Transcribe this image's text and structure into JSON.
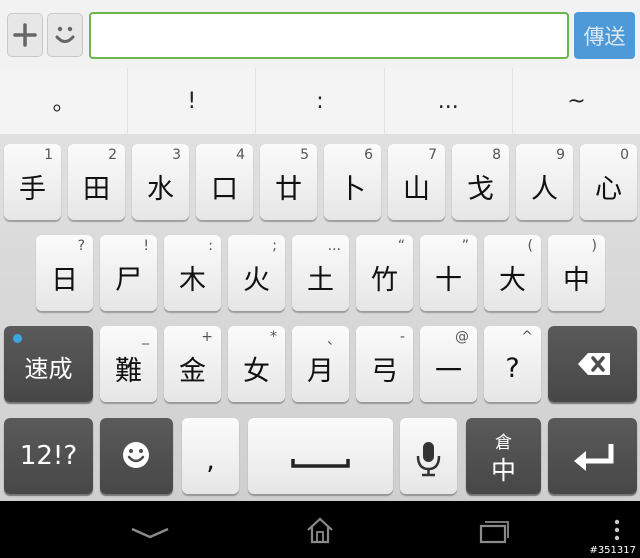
{
  "composer": {
    "send_label": "傳送",
    "input_value": "",
    "attach_icon": "plus-icon",
    "emoji_icon": "smiley-icon"
  },
  "suggestions": [
    "。",
    "!",
    ":",
    "...",
    "~"
  ],
  "keyboard": {
    "row1": [
      {
        "main": "手",
        "sub": "1"
      },
      {
        "main": "田",
        "sub": "2"
      },
      {
        "main": "水",
        "sub": "3"
      },
      {
        "main": "口",
        "sub": "4"
      },
      {
        "main": "廿",
        "sub": "5"
      },
      {
        "main": "卜",
        "sub": "6"
      },
      {
        "main": "山",
        "sub": "7"
      },
      {
        "main": "戈",
        "sub": "8"
      },
      {
        "main": "人",
        "sub": "9"
      },
      {
        "main": "心",
        "sub": "0"
      }
    ],
    "row2": [
      {
        "main": "日",
        "sub": "?"
      },
      {
        "main": "尸",
        "sub": "!"
      },
      {
        "main": "木",
        "sub": ":"
      },
      {
        "main": "火",
        "sub": ";"
      },
      {
        "main": "土",
        "sub": "..."
      },
      {
        "main": "竹",
        "sub": "“"
      },
      {
        "main": "十",
        "sub": "”"
      },
      {
        "main": "大",
        "sub": "("
      },
      {
        "main": "中",
        "sub": ")"
      }
    ],
    "row3": [
      {
        "main": "難",
        "sub": "_"
      },
      {
        "main": "金",
        "sub": "+"
      },
      {
        "main": "女",
        "sub": "*"
      },
      {
        "main": "月",
        "sub": "、"
      },
      {
        "main": "弓",
        "sub": "-"
      },
      {
        "main": "一",
        "sub": "@"
      },
      {
        "main": "?",
        "sub": "^"
      }
    ],
    "mode_label": "速成",
    "symbols_label": "12!?",
    "comma_label": ",",
    "lang_top": "倉",
    "lang_main": "中",
    "backspace_icon": "backspace-icon",
    "enter_icon": "enter-icon",
    "emoji_icon": "smiley-icon",
    "space_icon": "space-icon",
    "mic_icon": "microphone-icon"
  },
  "navbar": {
    "back_icon": "back-chevron-icon",
    "home_icon": "home-icon",
    "recents_icon": "recents-icon",
    "menu_icon": "overflow-menu-icon"
  },
  "watermark": "#351317"
}
